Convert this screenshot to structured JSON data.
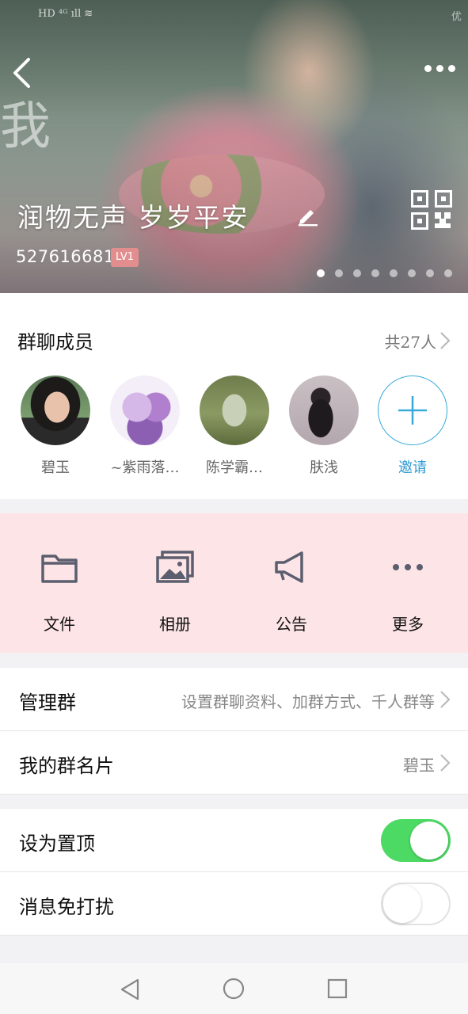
{
  "hero": {
    "status_left": "HD ⁴ᴳ ıll ≋",
    "status_right": "优",
    "watermark": "我",
    "group_name": "润物无声 岁岁平安",
    "group_id": "527616681",
    "level": "LV1",
    "page_count": 8,
    "active_page": 1
  },
  "members": {
    "title": "群聊成员",
    "count_text": "共27人",
    "list": [
      {
        "name": "碧玉",
        "icon": "avatar-woman-portrait"
      },
      {
        "name": "~紫雨落…",
        "icon": "avatar-anime-couple"
      },
      {
        "name": "陈学霸…",
        "icon": "avatar-garden-scene"
      },
      {
        "name": "肤浅",
        "icon": "avatar-dark-silhouette"
      }
    ],
    "invite_label": "邀请"
  },
  "actions": [
    {
      "label": "文件",
      "icon": "folder-icon"
    },
    {
      "label": "相册",
      "icon": "photo-album-icon"
    },
    {
      "label": "公告",
      "icon": "megaphone-icon"
    },
    {
      "label": "更多",
      "icon": "more-dots-icon"
    }
  ],
  "settings": {
    "manage_label": "管理群",
    "manage_hint": "设置群聊资料、加群方式、千人群等",
    "card_label": "我的群名片",
    "card_value": "碧玉",
    "pin_label": "设为置顶",
    "pin_on": true,
    "mute_label": "消息免打扰",
    "mute_on": false
  },
  "colors": {
    "accent_green": "#4cd964",
    "invite_blue": "#2f9bd2",
    "action_bg": "#fde4e6",
    "level_badge": "#e38e8e"
  }
}
